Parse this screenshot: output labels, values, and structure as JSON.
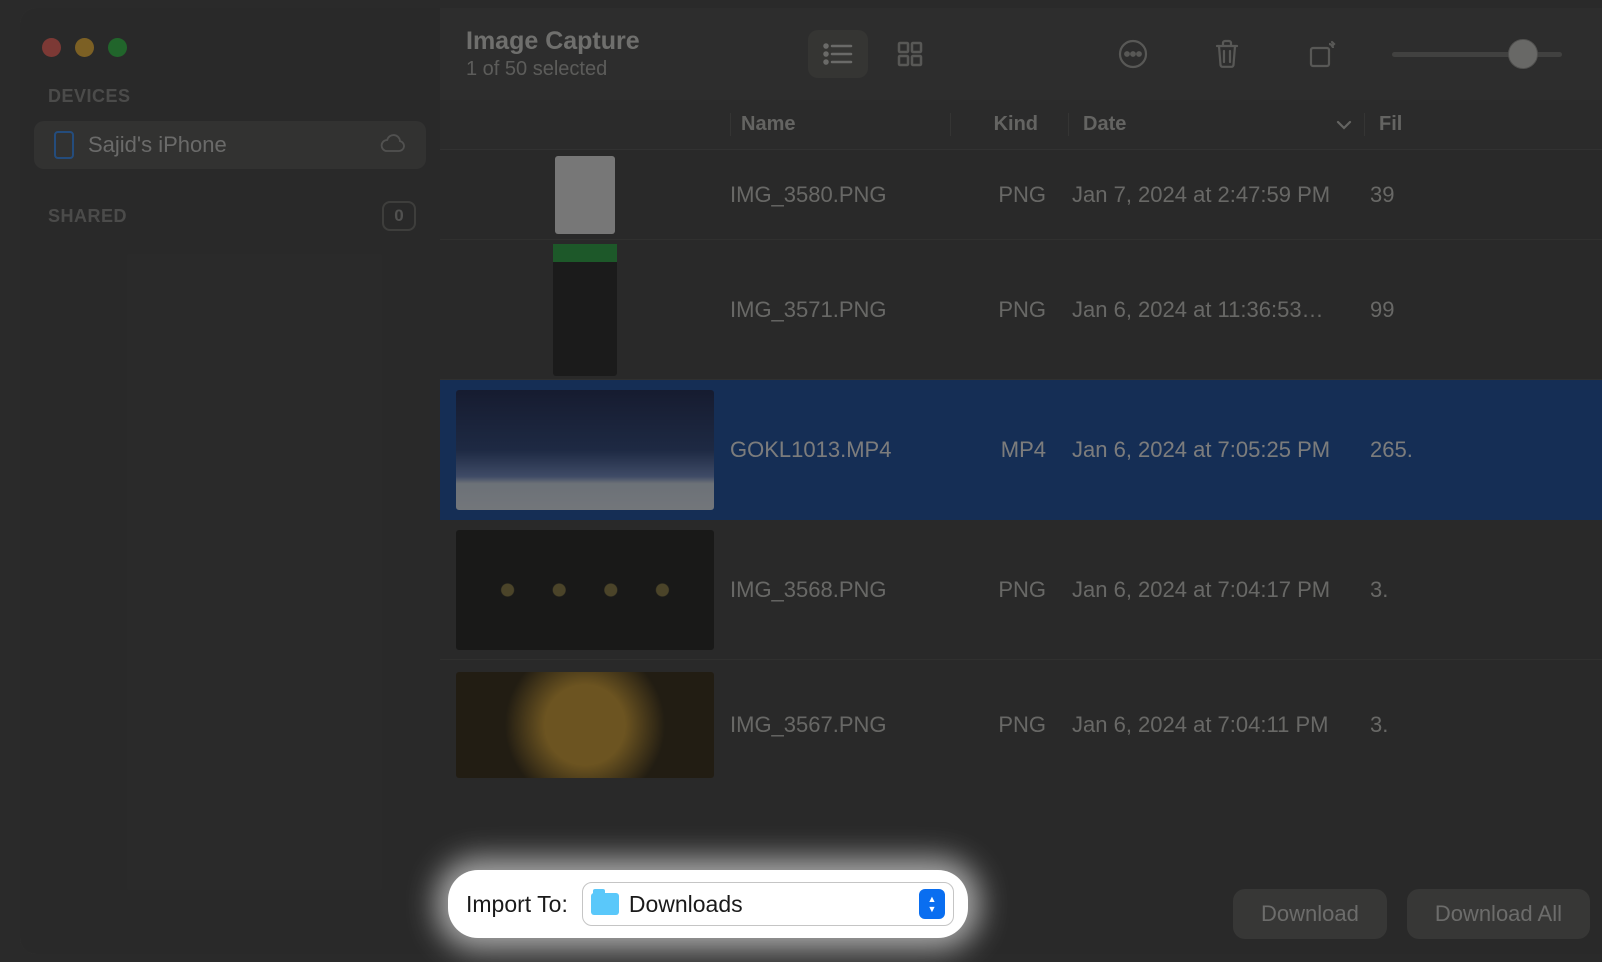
{
  "header": {
    "title": "Image Capture",
    "subtitle": "1 of 50 selected"
  },
  "sidebar": {
    "devices_label": "DEVICES",
    "device_name": "Sajid's iPhone",
    "shared_label": "SHARED",
    "shared_count": "0"
  },
  "columns": {
    "name": "Name",
    "kind": "Kind",
    "date": "Date",
    "file": "Fil"
  },
  "rows": [
    {
      "name": "IMG_3580.PNG",
      "kind": "PNG",
      "date": "Jan 7, 2024 at 2:47:59 PM",
      "file": "39"
    },
    {
      "name": "IMG_3571.PNG",
      "kind": "PNG",
      "date": "Jan 6, 2024 at 11:36:53…",
      "file": "99"
    },
    {
      "name": "GOKL1013.MP4",
      "kind": "MP4",
      "date": "Jan 6, 2024 at 7:05:25 PM",
      "file": "265."
    },
    {
      "name": "IMG_3568.PNG",
      "kind": "PNG",
      "date": "Jan 6, 2024 at 7:04:17 PM",
      "file": "3."
    },
    {
      "name": "IMG_3567.PNG",
      "kind": "PNG",
      "date": "Jan 6, 2024 at 7:04:11 PM",
      "file": "3."
    }
  ],
  "import": {
    "label": "Import To:",
    "destination": "Downloads"
  },
  "buttons": {
    "download": "Download",
    "download_all": "Download All"
  }
}
